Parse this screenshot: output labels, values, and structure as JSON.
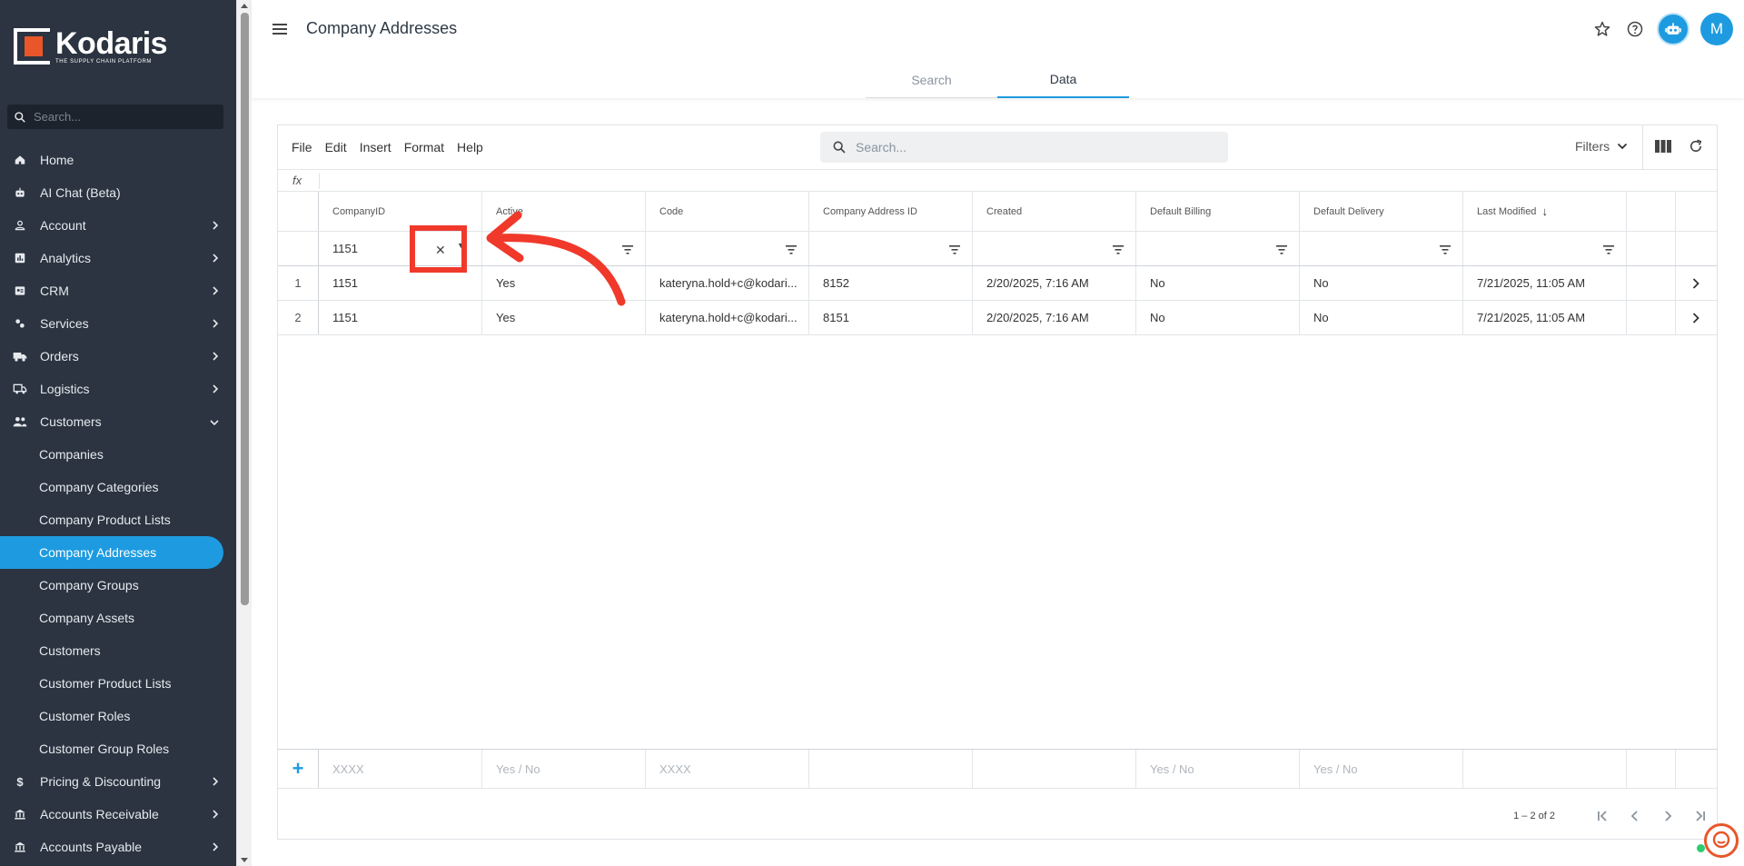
{
  "brand": {
    "name": "Kodaris",
    "tagline": "THE SUPPLY CHAIN PLATFORM",
    "accent": "#1e9be0",
    "logo_orange": "#e8562a"
  },
  "sidebar": {
    "search_placeholder": "Search...",
    "items": [
      {
        "label": "Home",
        "icon": "home-icon"
      },
      {
        "label": "AI Chat (Beta)",
        "icon": "robot-icon"
      },
      {
        "label": "Account",
        "icon": "person-icon"
      },
      {
        "label": "Analytics",
        "icon": "analytics-icon"
      },
      {
        "label": "CRM",
        "icon": "crm-icon"
      },
      {
        "label": "Services",
        "icon": "services-icon"
      },
      {
        "label": "Orders",
        "icon": "truck-icon"
      },
      {
        "label": "Logistics",
        "icon": "delivery-icon"
      },
      {
        "label": "Customers",
        "icon": "people-icon"
      },
      {
        "label": "Pricing & Discounting",
        "icon": "dollar-icon"
      },
      {
        "label": "Accounts Receivable",
        "icon": "bank-icon"
      },
      {
        "label": "Accounts Payable",
        "icon": "bank-icon"
      }
    ],
    "customers_sub": [
      "Companies",
      "Company Categories",
      "Company Product Lists",
      "Company Addresses",
      "Company Groups",
      "Company Assets",
      "Customers",
      "Customer Product Lists",
      "Customer Roles",
      "Customer Group Roles"
    ]
  },
  "header": {
    "title": "Company Addresses",
    "avatar_initial": "M",
    "tabs": [
      "Search",
      "Data"
    ]
  },
  "toolbar": {
    "menus": [
      "File",
      "Edit",
      "Insert",
      "Format",
      "Help"
    ],
    "search_placeholder": "Search...",
    "filters_label": "Filters",
    "fx_label": "fx"
  },
  "grid": {
    "columns": [
      "CompanyID",
      "Active",
      "Code",
      "Company Address ID",
      "Created",
      "Default Billing",
      "Default Delivery",
      "Last Modified"
    ],
    "filter_companyid": "1151",
    "rows": [
      {
        "num": "1",
        "CompanyID": "1151",
        "Active": "Yes",
        "Code": "kateryna.hold+c@kodari...",
        "AddressID": "8152",
        "Created": "2/20/2025, 7:16 AM",
        "Billing": "No",
        "Delivery": "No",
        "Modified": "7/21/2025, 11:05 AM"
      },
      {
        "num": "2",
        "CompanyID": "1151",
        "Active": "Yes",
        "Code": "kateryna.hold+c@kodari...",
        "AddressID": "8151",
        "Created": "2/20/2025, 7:16 AM",
        "Billing": "No",
        "Delivery": "No",
        "Modified": "7/21/2025, 11:05 AM"
      }
    ],
    "new_row": {
      "CompanyID": "XXXX",
      "Active": "Yes / No",
      "Code": "XXXX",
      "Billing": "Yes / No",
      "Delivery": "Yes / No"
    },
    "pagination": "1 – 2 of 2"
  },
  "annotation_color": "#f0392b"
}
